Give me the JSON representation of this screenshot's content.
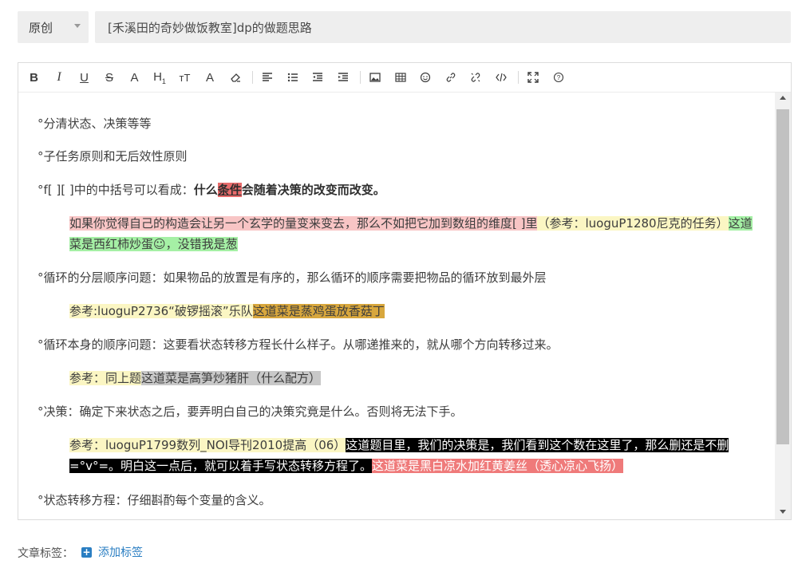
{
  "header": {
    "type_select": "原创",
    "title": "[禾溪田的奇妙做饭教室]dp的做题思路"
  },
  "toolbar": {
    "bold": "B",
    "italic": "I",
    "underline": "U",
    "strike": "S",
    "font_color": "A",
    "heading": "H",
    "heading_sub": "1",
    "font_size": "тT",
    "bg_color": "A",
    "help": "?"
  },
  "content": {
    "p1": "°分清状态、决策等等",
    "p2": "°子任务原则和无后效性原则",
    "p3_prefix": "°f[ ][ ]中的中括号可以看成：",
    "p3_bold1": "什么",
    "p3_bold_hl": "条件",
    "p3_bold2": "会随着决策的改变而改变。",
    "p4_pink": "如果你觉得自己的构造会让另一个玄学的量变来变去，那么不如把它加到数组的维度[ ]里",
    "p4_yellow": "（参考：luoguP1280尼克的任务）",
    "p4_green": "这道菜是西红柿炒蛋",
    "p4_green_icon": "☺",
    "p4_green2": "，没错我是葱",
    "p5": "°循环的分层顺序问题：如果物品的放置是有序的，那么循环的顺序需要把物品的循环放到最外层",
    "p6_yellow": "参考:luoguP2736“破锣摇滚”乐队",
    "p6_brown": "这道菜是蒸鸡蛋放香菇丁",
    "p7": "°循环本身的顺序问题：这要看状态转移方程长什么样子。从哪递推来的，就从哪个方向转移过来。",
    "p8_yellow": "参考：同上题",
    "p8_gray": "这道菜是高笋炒猪肝（什么配方）",
    "p9": "°决策：确定下来状态之后，要弄明白自己的决策究竟是什么。否则将无法下手。",
    "p10_yellow": "参考：luoguP1799数列_NOI导刊2010提高（06）",
    "p10_black": "这道题目里，我们的决策是，我们看到这个数在这里了，那么删还是不删=°v°=。明白这一点后，就可以着手写状态转移方程了。",
    "p10_salmon": "这道菜是黑白凉水加红黄姜丝（透心凉心飞扬）",
    "p11": "°状态转移方程：仔细斟酌每个变量的含义。"
  },
  "footer": {
    "tags_label": "文章标签：",
    "add_tag": "添加标签",
    "add_tag_icon": "+"
  }
}
